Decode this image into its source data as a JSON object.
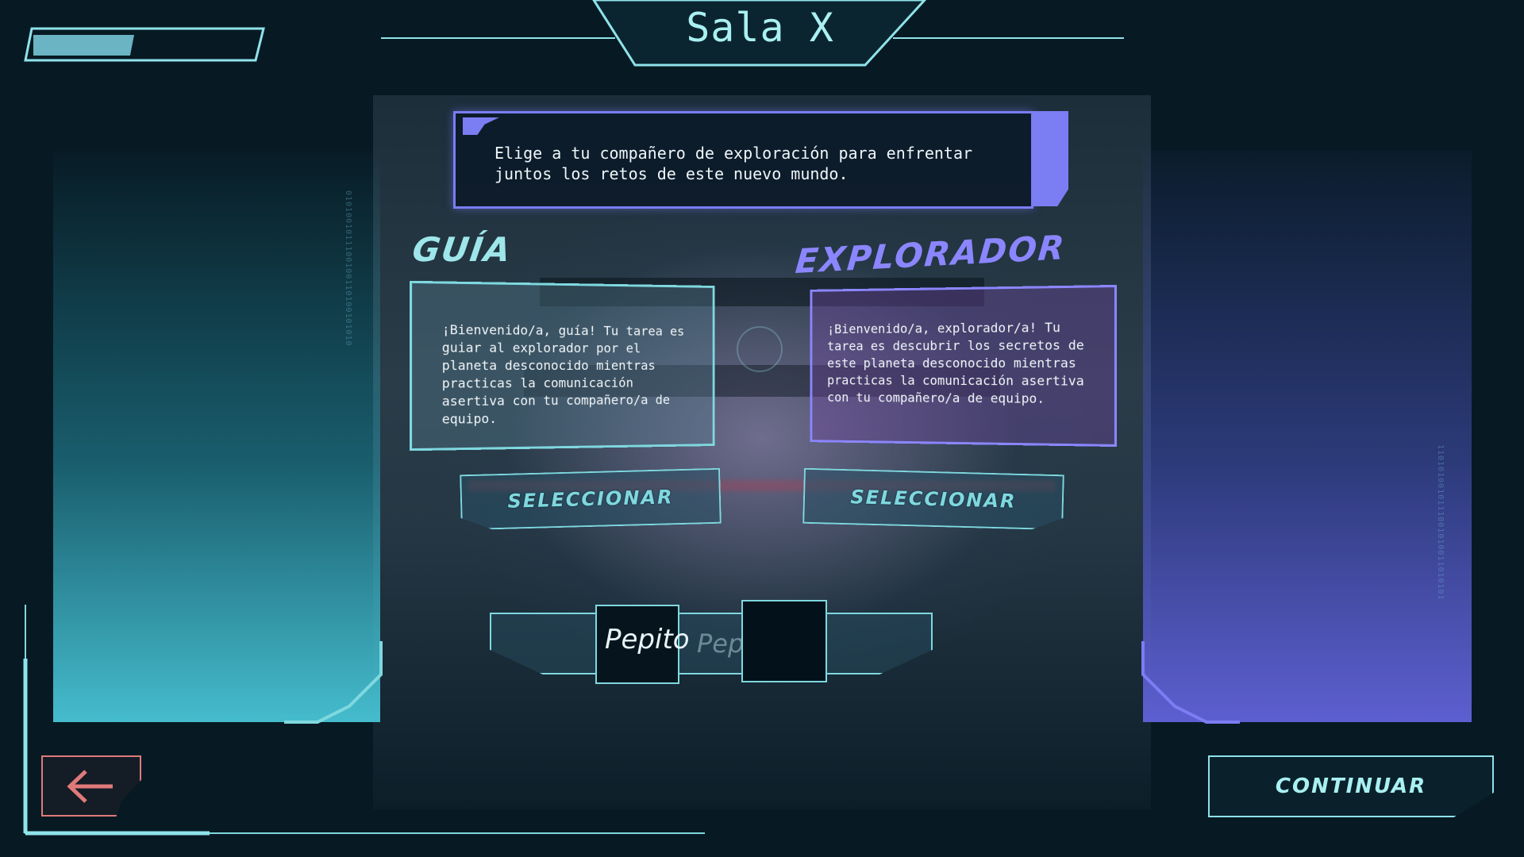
{
  "header": {
    "title": "Sala X"
  },
  "progress": {
    "fraction": 0.45
  },
  "instructions": {
    "text": "Elige a tu compañero de exploración para enfrentar juntos los retos de este nuevo mundo."
  },
  "roles": [
    {
      "name": "GUÍA",
      "description": "¡Bienvenido/a, guía! Tu tarea es guiar al explorador por el planeta desconocido mientras practicas la comunicación asertiva con tu compañero/a de equipo.",
      "select_label": "SELECCIONAR",
      "color": "#9ee6ea"
    },
    {
      "name": "EXPLORADOR",
      "description": "¡Bienvenido/a, explorador/a! Tu tarea es descubrir los secretos de este planeta desconocido mientras practicas la comunicación asertiva con tu compañero/a de equipo.",
      "select_label": "SELECCIONAR",
      "color": "#8b86ff"
    }
  ],
  "player": {
    "name": "Pepito",
    "name_ghost": "Pep"
  },
  "footer": {
    "back_icon": "arrow-left-icon",
    "continue_label": "CONTINUAR"
  },
  "colors": {
    "accent_cyan": "#8fe3ea",
    "accent_purple": "#7b7df2",
    "back_red": "#e07a7a",
    "background": "#071a24"
  }
}
